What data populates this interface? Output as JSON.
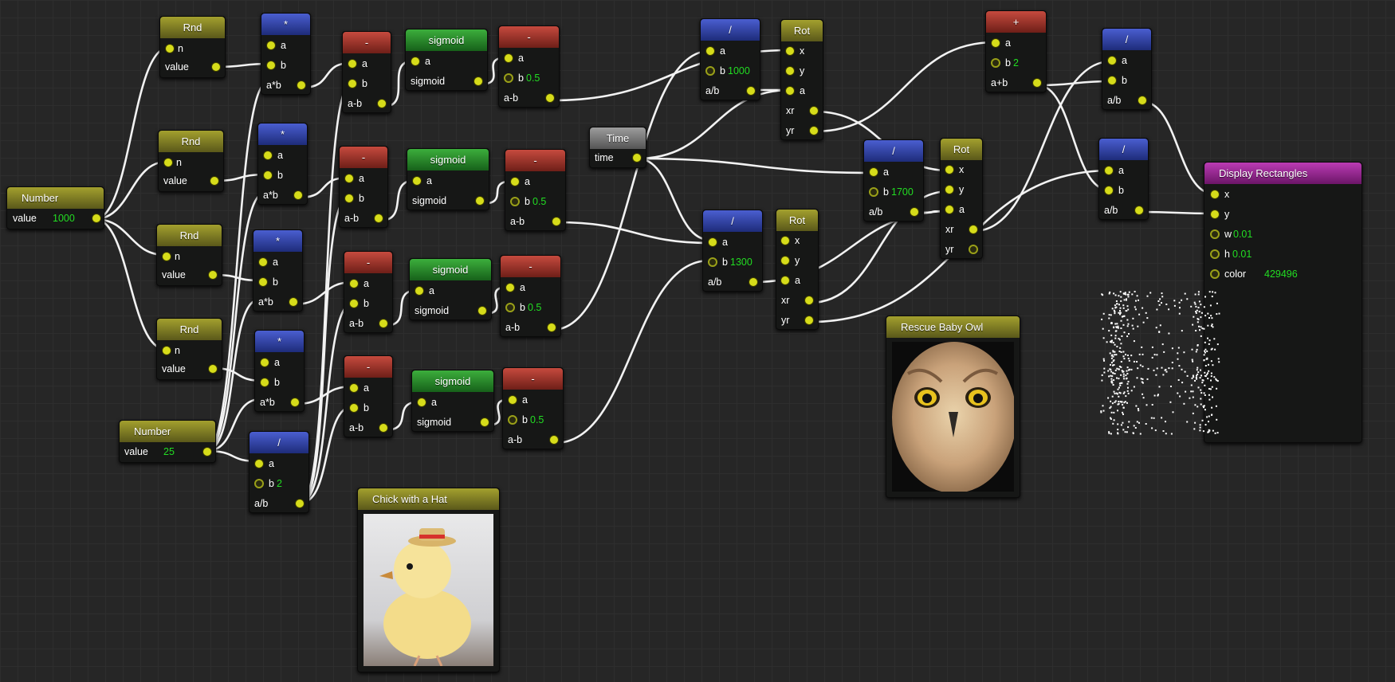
{
  "nodes": {
    "number1": {
      "title": "Number",
      "value_label": "value",
      "value": "1000"
    },
    "number2": {
      "title": "Number",
      "value_label": "value",
      "value": "25"
    },
    "rnd": {
      "title": "Rnd",
      "in": "n",
      "out": "value"
    },
    "mul": {
      "title": "*",
      "a": "a",
      "b": "b",
      "out": "a*b"
    },
    "sub": {
      "title": "-",
      "a": "a",
      "b": "b",
      "out": "a-b"
    },
    "sub_const": {
      "title": "-",
      "a": "a",
      "b": "b",
      "b_value": "0.5",
      "out": "a-b"
    },
    "sigmoid": {
      "title": "sigmoid",
      "in": "a",
      "out": "sigmoid"
    },
    "div": {
      "title": "/",
      "a": "a",
      "b": "b",
      "out": "a/b"
    },
    "div_half": {
      "title": "/",
      "a": "a",
      "b": "b",
      "b_value": "2",
      "out": "a/b"
    },
    "div1000": {
      "b_value": "1000"
    },
    "div1300": {
      "b_value": "1300"
    },
    "div1700": {
      "b_value": "1700"
    },
    "time": {
      "title": "Time",
      "out": "time"
    },
    "rot": {
      "title": "Rot",
      "x": "x",
      "y": "y",
      "a": "a",
      "xr": "xr",
      "yr": "yr"
    },
    "plus": {
      "title": "+",
      "a": "a",
      "b": "b",
      "b_value": "2",
      "out": "a+b"
    },
    "display": {
      "title": "Display Rectangles",
      "x": "x",
      "y": "y",
      "w": "w",
      "w_value": "0.01",
      "h": "h",
      "h_value": "0.01",
      "color": "color",
      "color_value": "429496"
    },
    "owl": {
      "title": "Rescue Baby Owl"
    },
    "chick": {
      "title": "Chick with a Hat"
    }
  },
  "colors": {
    "wire": "#f2f2f2",
    "port": "#d6dc1a",
    "value": "#22dd22",
    "number_header": "#a3a02e",
    "math_header": "#3a4fc0",
    "sub_header": "#c64a3e",
    "sigmoid_header": "#3cae3c",
    "display_header": "#bb3bb4",
    "time_header": "#9d9d9d"
  }
}
